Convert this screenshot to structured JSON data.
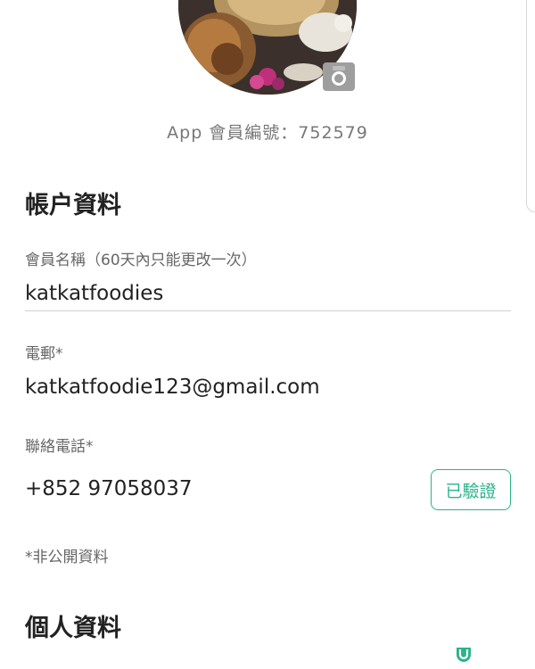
{
  "profile": {
    "member_id_label": "App 會員編號：752579"
  },
  "account_section": {
    "title": "帳户資料",
    "name_label": "會員名稱（60天內只能更改一次）",
    "name_value": "katkatfoodies",
    "email_label": "電郵*",
    "email_value": "katkatfoodie123@gmail.com",
    "phone_label": "聯絡電話*",
    "phone_value": "+852 97058037",
    "verified_label": "已驗證",
    "private_note": "*非公開資料"
  },
  "personal_section": {
    "title": "個人資料"
  },
  "icons": {
    "camera": "camera-icon",
    "logo": "u-logo-icon"
  },
  "colors": {
    "accent": "#2bb38a",
    "text": "#222222",
    "muted": "#666666"
  }
}
